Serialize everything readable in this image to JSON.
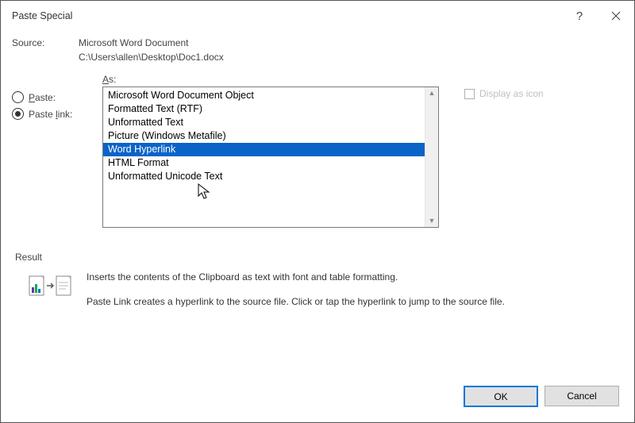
{
  "title": "Paste Special",
  "source_label": "Source:",
  "source_app": "Microsoft Word Document",
  "source_path": "C:\\Users\\allen\\Desktop\\Doc1.docx",
  "radios": {
    "paste": "Paste:",
    "paste_link": "Paste link:",
    "selected": "paste_link"
  },
  "as_label": "As:",
  "list_items": [
    "Microsoft Word Document Object",
    "Formatted Text (RTF)",
    "Unformatted Text",
    "Picture (Windows Metafile)",
    "Word Hyperlink",
    "HTML Format",
    "Unformatted Unicode Text"
  ],
  "list_selected_index": 4,
  "display_as_icon": {
    "label": "Display as icon",
    "checked": false,
    "enabled": false
  },
  "result": {
    "heading": "Result",
    "line1": "Inserts the contents of the Clipboard as text with font and table formatting.",
    "line2": "Paste Link creates a hyperlink to the source file. Click or tap the hyperlink to jump to the source file."
  },
  "buttons": {
    "ok": "OK",
    "cancel": "Cancel"
  }
}
